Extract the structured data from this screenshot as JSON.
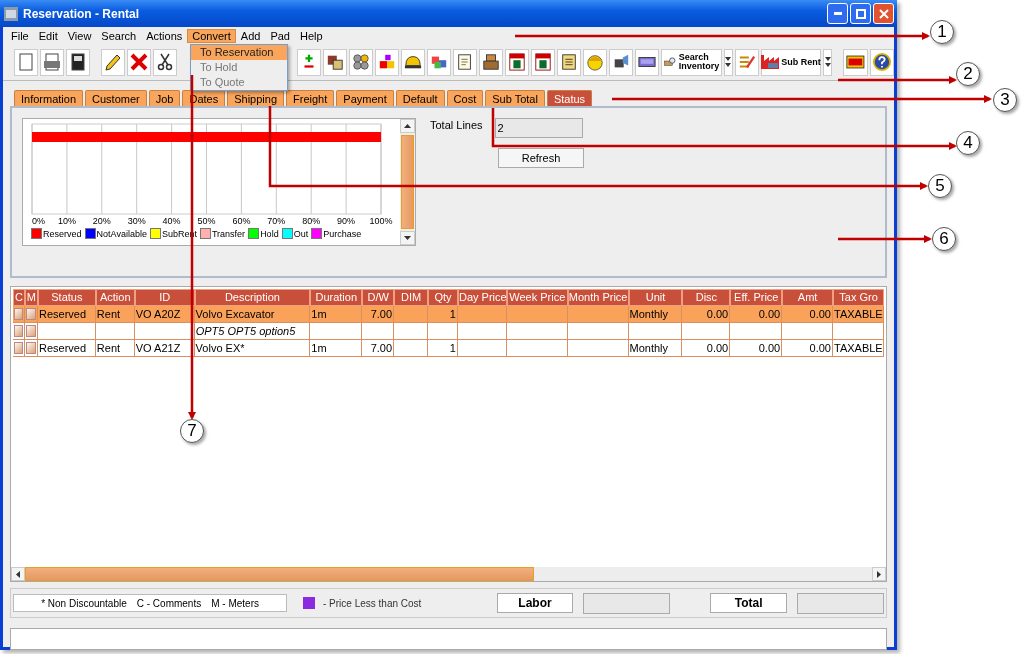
{
  "window": {
    "title": "Reservation - Rental"
  },
  "menu": [
    {
      "label": "File",
      "selected": false
    },
    {
      "label": "Edit",
      "selected": false
    },
    {
      "label": "View",
      "selected": false
    },
    {
      "label": "Search",
      "selected": false
    },
    {
      "label": "Actions",
      "selected": false
    },
    {
      "label": "Convert",
      "selected": true
    },
    {
      "label": "Add",
      "selected": false
    },
    {
      "label": "Pad",
      "selected": false
    },
    {
      "label": "Help",
      "selected": false
    }
  ],
  "convert_menu": [
    {
      "label": "To Reservation",
      "selected": true,
      "disabled": false
    },
    {
      "label": "To Hold",
      "selected": false,
      "disabled": true
    },
    {
      "label": "To Quote",
      "selected": false,
      "disabled": true
    }
  ],
  "toolbar": {
    "search_inventory": "Search Inventory",
    "sub_rent": "Sub Rent"
  },
  "tabs": [
    {
      "label": "Information",
      "selected": false
    },
    {
      "label": "Customer",
      "selected": false
    },
    {
      "label": "Job",
      "selected": false
    },
    {
      "label": "Dates",
      "selected": false
    },
    {
      "label": "Shipping",
      "selected": false
    },
    {
      "label": "Freight",
      "selected": false
    },
    {
      "label": "Payment",
      "selected": false
    },
    {
      "label": "Default",
      "selected": false
    },
    {
      "label": "Cost",
      "selected": false
    },
    {
      "label": "Sub Total",
      "selected": false
    },
    {
      "label": "Status",
      "selected": true
    }
  ],
  "status_panel": {
    "chart_data": {
      "type": "bar",
      "orientation": "horizontal",
      "stacked": true,
      "xlim": [
        0,
        100
      ],
      "grid": true,
      "xticks": [
        {
          "value": 0,
          "label": "0%"
        },
        {
          "value": 10,
          "label": "10%"
        },
        {
          "value": 20,
          "label": "20%"
        },
        {
          "value": 30,
          "label": "30%"
        },
        {
          "value": 40,
          "label": "40%"
        },
        {
          "value": 50,
          "label": "50%"
        },
        {
          "value": 60,
          "label": "60%"
        },
        {
          "value": 70,
          "label": "70%"
        },
        {
          "value": 80,
          "label": "80%"
        },
        {
          "value": 90,
          "label": "90%"
        },
        {
          "value": 100,
          "label": "100%"
        }
      ],
      "series": [
        {
          "name": "Reserved",
          "color": "#ff0000",
          "values": [
            100
          ]
        },
        {
          "name": "NotAvailable",
          "color": "#0000ff",
          "values": [
            0
          ]
        },
        {
          "name": "SubRent",
          "color": "#ffff00",
          "values": [
            0
          ]
        },
        {
          "name": "Transfer",
          "color": "#ffafaf",
          "values": [
            0
          ]
        },
        {
          "name": "Hold",
          "color": "#00ff00",
          "values": [
            0
          ]
        },
        {
          "name": "Out",
          "color": "#00ffff",
          "values": [
            0
          ]
        },
        {
          "name": "Purchase",
          "color": "#ff00ff",
          "values": [
            0
          ]
        }
      ]
    },
    "total_lines_label": "Total Lines",
    "total_lines_value": "2",
    "refresh_button": "Refresh"
  },
  "table": {
    "columns": [
      "C",
      "M",
      "Status",
      "Action",
      "ID",
      "Description",
      "Duration",
      "D/W",
      "DIM",
      "Qty",
      "Day Price",
      "Week Price",
      "Month Price",
      "Unit",
      "Disc",
      "Eff. Price",
      "Amt",
      "Tax Gro"
    ],
    "rows": [
      {
        "kind": "item",
        "selected": true,
        "cells": [
          null,
          null,
          "Reserved",
          "Rent",
          "VO A20Z",
          "Volvo Excavator",
          "1m",
          "7.00",
          null,
          "1",
          null,
          null,
          null,
          "Monthly",
          "0.00",
          "0.00",
          "0.00",
          "TAXABLE"
        ]
      },
      {
        "kind": "option",
        "selected": false,
        "cells": [
          null,
          null,
          null,
          null,
          null,
          "OPT5 OPT5 option5",
          null,
          null,
          null,
          null,
          null,
          null,
          null,
          null,
          null,
          null,
          null,
          null
        ]
      },
      {
        "kind": "item",
        "selected": false,
        "cells": [
          null,
          null,
          "Reserved",
          "Rent",
          "VO A21Z",
          "Volvo EX*",
          "1m",
          "7.00",
          null,
          "1",
          null,
          null,
          null,
          "Monthly",
          "0.00",
          "0.00",
          "0.00",
          "TAXABLE"
        ]
      }
    ]
  },
  "footer": {
    "legend": [
      "* Non Discountable",
      "C - Comments",
      "M - Meters"
    ],
    "price_note": "- Price Less than Cost",
    "labor_label": "Labor",
    "total_label": "Total"
  },
  "callouts": [
    {
      "number": "1"
    },
    {
      "number": "2"
    },
    {
      "number": "3"
    },
    {
      "number": "4"
    },
    {
      "number": "5"
    },
    {
      "number": "6"
    },
    {
      "number": "7"
    }
  ]
}
